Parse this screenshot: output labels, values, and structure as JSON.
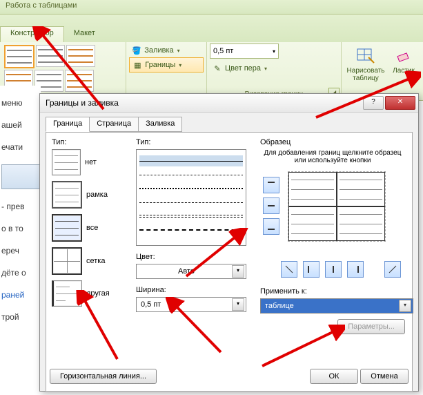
{
  "ribbon": {
    "context_title": "Работа с таблицами",
    "tabs": [
      "Конструктор",
      "Макет"
    ],
    "active_tab": "Конструктор",
    "shading_label": "Заливка",
    "borders_label": "Границы",
    "weight_value": "0,5 пт",
    "pen_color_label": "Цвет пера",
    "draw_table_label": "Нарисовать таблицу",
    "eraser_label": "Ластик",
    "group_draw_label": "Рисование границ"
  },
  "doc_fragments": [
    "меню",
    "ашей",
    "ечати",
    "- прев",
    "о в то",
    "ереч",
    "дёте о",
    "раней",
    "трой"
  ],
  "dialog": {
    "title": "Границы и заливка",
    "tabs": [
      "Граница",
      "Страница",
      "Заливка"
    ],
    "active_tab": "Граница",
    "type_label": "Тип:",
    "style_label": "Тип:",
    "color_label": "Цвет:",
    "color_value": "Авто",
    "width_label": "Ширина:",
    "width_value": "0,5 пт",
    "preview_label": "Образец",
    "preview_hint": "Для добавления границ щелкните образец или используйте кнопки",
    "apply_label": "Применить к:",
    "apply_value": "таблице",
    "options_btn": "Параметры...",
    "hline_btn": "Горизонтальная линия...",
    "ok_btn": "ОК",
    "cancel_btn": "Отмена",
    "presets": [
      {
        "key": "none",
        "label": "нет"
      },
      {
        "key": "box",
        "label": "рамка"
      },
      {
        "key": "all",
        "label": "все"
      },
      {
        "key": "grid",
        "label": "сетка"
      },
      {
        "key": "custom",
        "label": "другая"
      }
    ],
    "selected_preset": "все"
  }
}
